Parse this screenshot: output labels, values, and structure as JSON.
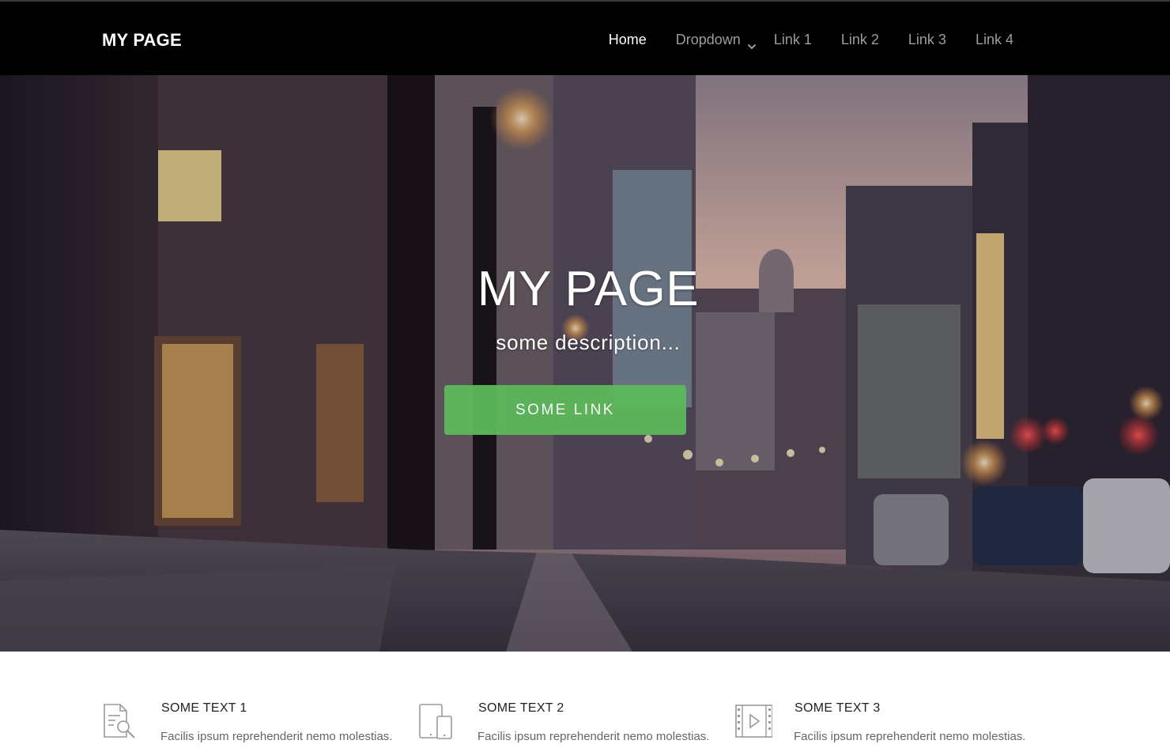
{
  "navbar": {
    "brand": "MY PAGE",
    "items": [
      {
        "label": "Home",
        "active": true
      },
      {
        "label": "Dropdown",
        "dropdown": true
      },
      {
        "label": "Link 1"
      },
      {
        "label": "Link 2"
      },
      {
        "label": "Link 3"
      },
      {
        "label": "Link 4"
      }
    ]
  },
  "hero": {
    "title": "MY PAGE",
    "description": "some description...",
    "button_label": "SOME LINK",
    "button_color": "#5cb85c"
  },
  "features": [
    {
      "icon": "search-document-icon",
      "title": "SOME TEXT 1",
      "text": "Facilis ipsum reprehenderit nemo molestias."
    },
    {
      "icon": "devices-icon",
      "title": "SOME TEXT 2",
      "text": "Facilis ipsum reprehenderit nemo molestias."
    },
    {
      "icon": "video-icon",
      "title": "SOME TEXT 3",
      "text": "Facilis ipsum reprehenderit nemo molestias."
    }
  ],
  "colors": {
    "navbar_bg": "#000000",
    "nav_active": "#ffffff",
    "nav_inactive": "#9d9d9d",
    "accent": "#5cb85c"
  }
}
